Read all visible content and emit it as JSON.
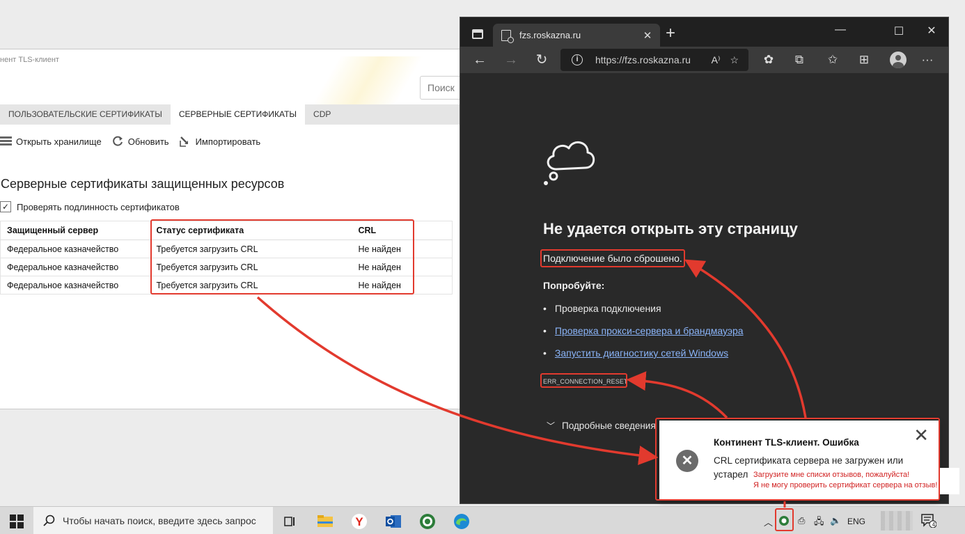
{
  "tls_window": {
    "title": "нент TLS-клиент",
    "search_placeholder": "Поиск",
    "tabs": [
      {
        "label": "ПОЛЬЗОВАТЕЛЬСКИЕ СЕРТИФИКАТЫ",
        "active": false
      },
      {
        "label": "СЕРВЕРНЫЕ СЕРТИФИКАТЫ",
        "active": true
      },
      {
        "label": "CDP",
        "active": false
      }
    ],
    "toolbar": {
      "open_store": "Открыть хранилище",
      "refresh": "Обновить",
      "import": "Импортировать"
    },
    "heading": "Серверные сертификаты защищенных ресурсов",
    "verify_label": "Проверять подлинность сертификатов",
    "verify_checked": true,
    "table": {
      "headers": [
        "Защищенный сервер",
        "Статус сертификата",
        "CRL"
      ],
      "rows": [
        [
          "Федеральное казначейство",
          "Требуется загрузить CRL",
          "Не найден"
        ],
        [
          "Федеральное казначейство",
          "Требуется загрузить CRL",
          "Не найден"
        ],
        [
          "Федеральное казначейство",
          "Требуется загрузить CRL",
          "Не найден"
        ]
      ]
    }
  },
  "browser": {
    "tab_title": "fzs.roskazna.ru",
    "url": "https://fzs.roskazna.ru",
    "error": {
      "heading": "Не удается открыть эту страницу",
      "subtext": "Подключение было сброшено.",
      "try_label": "Попробуйте:",
      "items": [
        {
          "text": "Проверка подключения",
          "link": false
        },
        {
          "text": "Проверка прокси-сервера и брандмауэра",
          "link": true
        },
        {
          "text": "Запустить диагностику сетей Windows",
          "link": true
        }
      ],
      "code": "ERR_CONNECTION_RESET",
      "details": "Подробные сведения"
    }
  },
  "toast": {
    "title": "Континент TLS-клиент. Ошибка",
    "message": "CRL сертификата сервера не загружен или устарел"
  },
  "note": {
    "line1": "Загрузите мне списки отзывов, пожалуйста!",
    "line2": "Я не могу проверить сертификат сервера на отзыв!"
  },
  "taskbar": {
    "search_placeholder": "Чтобы начать поиск, введите здесь запрос",
    "language": "ENG",
    "notification_count": "4"
  },
  "colors": {
    "annotation_red": "#e23a2e",
    "browser_bg": "#292929",
    "link_blue": "#8ab4f8"
  }
}
